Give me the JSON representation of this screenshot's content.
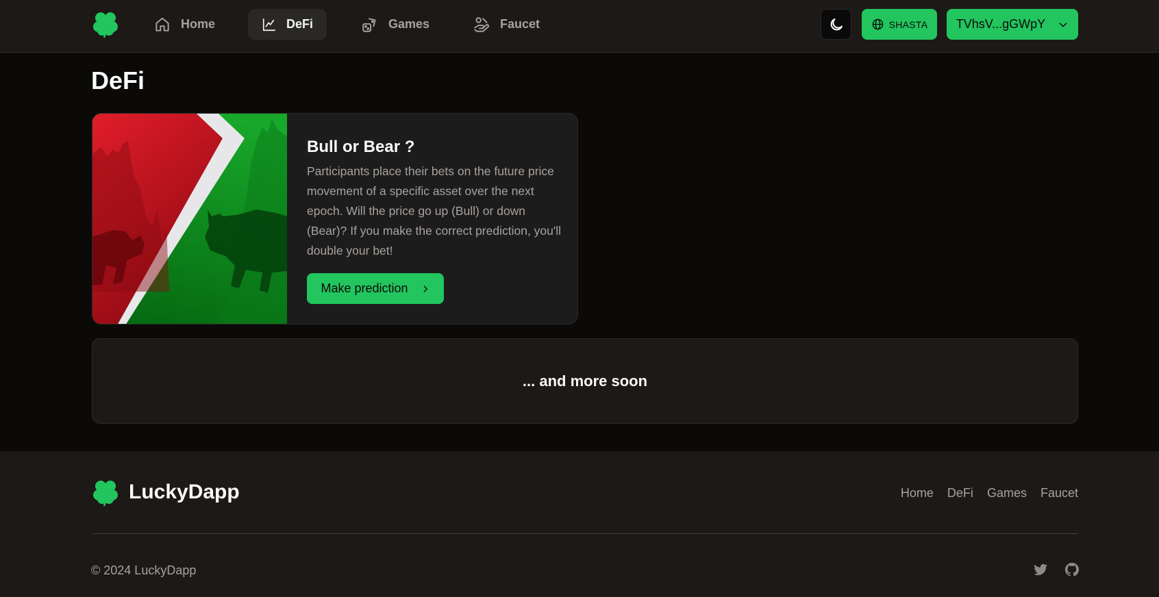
{
  "nav": {
    "items": [
      {
        "label": "Home",
        "icon": "home-icon"
      },
      {
        "label": "DeFi",
        "icon": "chart-line-icon",
        "active": true
      },
      {
        "label": "Games",
        "icon": "dice-icon"
      },
      {
        "label": "Faucet",
        "icon": "hand-coins-icon"
      }
    ],
    "theme_icon": "moon-icon",
    "network_label": "SHASTA",
    "wallet_label": "TVhsV...gGWpY"
  },
  "main": {
    "title": "DeFi",
    "card": {
      "title": "Bull or Bear ?",
      "description": "Participants place their bets on the future price movement of a specific asset over the next epoch. Will the price go up (Bull) or down (Bear)? If you make the correct prediction, you'll double your bet!",
      "button_label": "Make prediction"
    },
    "more_text": "... and more soon"
  },
  "footer": {
    "brand": "LuckyDapp",
    "links": [
      "Home",
      "DeFi",
      "Games",
      "Faucet"
    ],
    "copyright": "© 2024 LuckyDapp"
  },
  "colors": {
    "accent": "#22c55e",
    "background": "#0b0a09",
    "surface": "#1c1917"
  }
}
